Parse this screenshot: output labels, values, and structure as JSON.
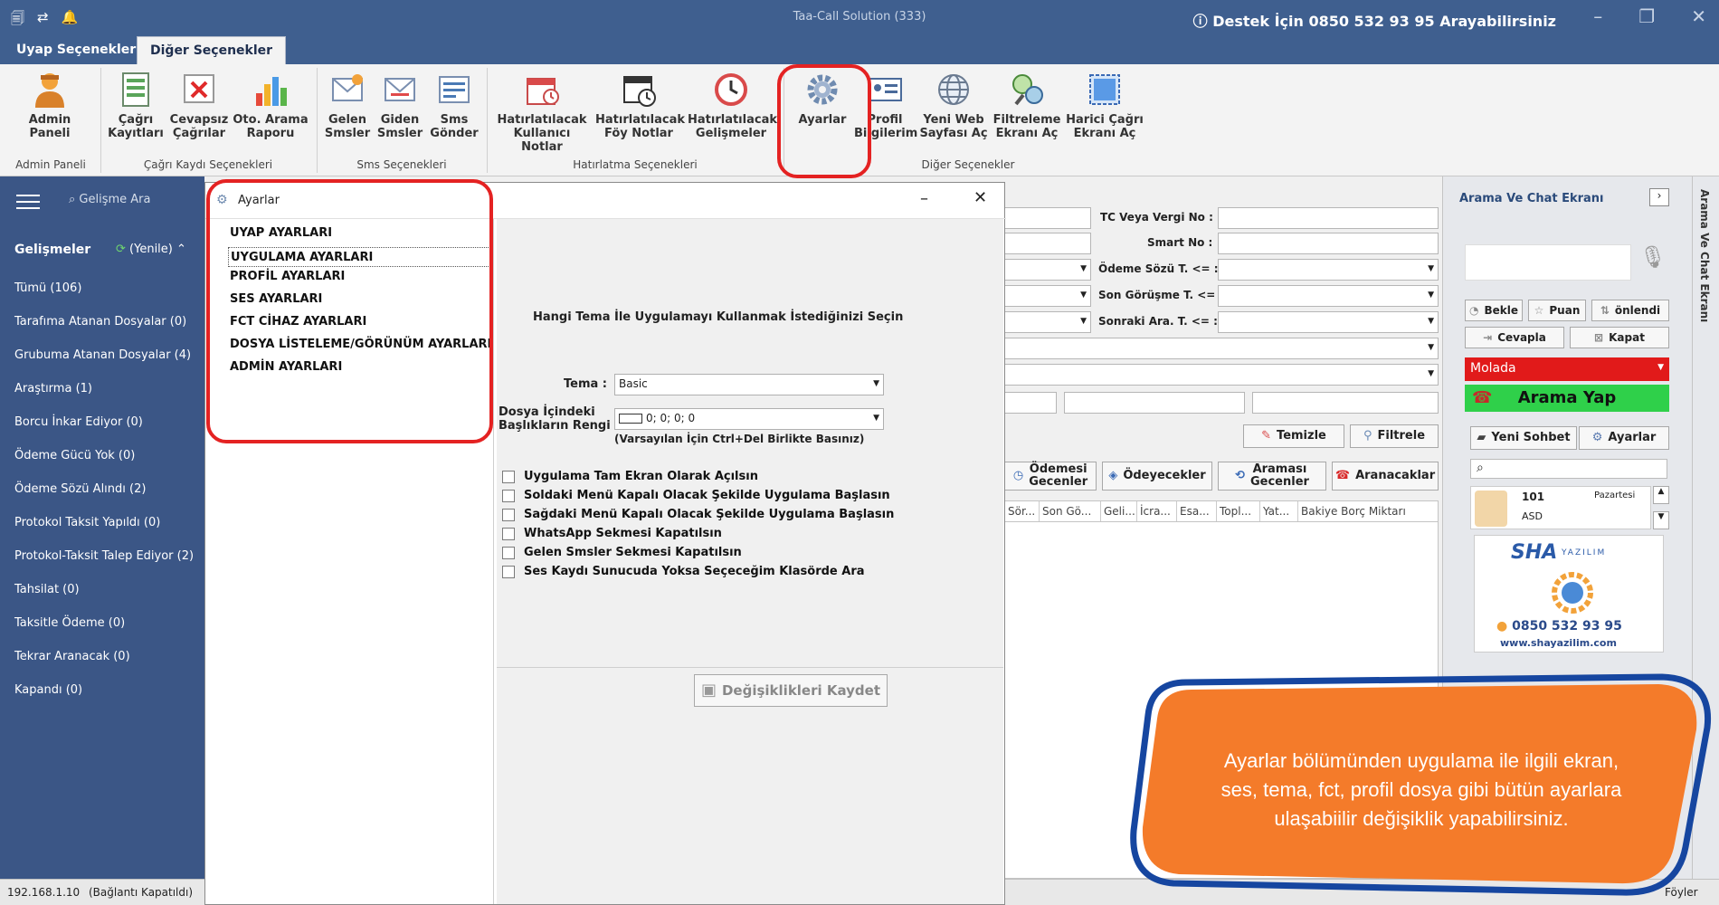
{
  "window": {
    "title": "Taa-Call Solution (333)",
    "support_text": "Destek İçin 0850 532 93 95 Arayabilirsiniz"
  },
  "tabs": [
    {
      "label": "Uyap Seçenekler",
      "active": false
    },
    {
      "label": "Diğer Seçenekler",
      "active": true
    }
  ],
  "ribbon": {
    "buttons": [
      {
        "l1": "Admin",
        "l2": "Paneli",
        "icon": "admin-person-icon"
      },
      {
        "l1": "Çağrı",
        "l2": "Kayıtları",
        "icon": "call-records-icon"
      },
      {
        "l1": "Cevapsız",
        "l2": "Çağrılar",
        "icon": "missed-calls-icon"
      },
      {
        "l1": "Oto. Arama",
        "l2": "Raporu",
        "icon": "bar-chart-icon"
      },
      {
        "l1": "Gelen",
        "l2": "Smsler",
        "icon": "incoming-sms-icon"
      },
      {
        "l1": "Giden",
        "l2": "Smsler",
        "icon": "outgoing-sms-icon"
      },
      {
        "l1": "Sms",
        "l2": "Gönder",
        "icon": "send-sms-icon"
      },
      {
        "l1": "Hatırlatılacak",
        "l2": "Kullanıcı Notlar",
        "icon": "calendar-alarm-icon"
      },
      {
        "l1": "Hatırlatılacak",
        "l2": "Föy Notlar",
        "icon": "calendar-clock-icon"
      },
      {
        "l1": "Hatırlatılacak",
        "l2": "Gelişmeler",
        "icon": "clock-icon"
      },
      {
        "l1": "Ayarlar",
        "l2": "",
        "icon": "gear-icon"
      },
      {
        "l1": "Profil",
        "l2": "Bilgilerim",
        "icon": "profile-card-icon"
      },
      {
        "l1": "Yeni Web",
        "l2": "Sayfası Aç",
        "icon": "globe-icon"
      },
      {
        "l1": "Filtreleme",
        "l2": "Ekranı Aç",
        "icon": "filter-icon"
      },
      {
        "l1": "Harici Çağrı",
        "l2": "Ekranı Aç",
        "icon": "external-window-icon"
      }
    ],
    "groups": [
      "Admin Paneli",
      "Çağrı Kaydı Seçenekleri",
      "Sms Seçenekleri",
      "Hatırlatma Seçenekleri",
      "Diğer Seçenekler"
    ]
  },
  "sidebar": {
    "search_placeholder": "Gelişme Ara",
    "section_title": "Gelişmeler",
    "refresh_label": "(Yenile)",
    "items": [
      "Tümü (106)",
      "Tarafıma Atanan Dosyalar (0)",
      "Grubuma Atanan Dosyalar (4)",
      "Araştırma (1)",
      "Borcu İnkar Ediyor (0)",
      "Ödeme Gücü Yok (0)",
      "Ödeme Sözü Alındı (2)",
      "Protokol Taksit Yapıldı (0)",
      "Protokol-Taksit Talep Ediyor (2)",
      "Tahsilat (0)",
      "Taksitle Ödeme (0)",
      "Tekrar Aranacak (0)",
      "Kapandı (0)"
    ]
  },
  "status": {
    "ip": "192.168.1.10",
    "connection": "(Bağlantı Kapatıldı)",
    "right_text": "Föyler"
  },
  "background_form": {
    "labels": [
      "TC Veya Vergi No :",
      "Smart No :",
      "Ödeme Sözü T. <= :",
      "Son Görüşme T. <= :",
      "Sonraki Ara. T. <= :"
    ],
    "clear_button": "Temizle",
    "filter_button": "Filtrele",
    "action_buttons": [
      {
        "l1": "Ödemesi",
        "l2": "Gecenler"
      },
      {
        "l1": "Ödeyecekler",
        "l2": ""
      },
      {
        "l1": "Araması",
        "l2": "Gecenler"
      },
      {
        "l1": "Aranacaklar",
        "l2": ""
      }
    ],
    "columns": [
      "Sör...",
      "Son Gö...",
      "Geli...",
      "İcra...",
      "Esa...",
      "Topl...",
      "Yat...",
      "Bakiye Borç Miktarı"
    ]
  },
  "chat": {
    "title": "Arama Ve Chat Ekranı",
    "vertical_title": "Arama Ve Chat Ekranı",
    "buttons": {
      "wait": "Bekle",
      "rate": "Puan",
      "priority": "önlendi",
      "answer": "Cevapla",
      "close": "Kapat"
    },
    "status_text": "Molada",
    "call_button": "Arama Yap",
    "new_chat": "Yeni Sohbet",
    "callers": "Ayarlar",
    "contact": {
      "number": "101",
      "day": "Pazartesi",
      "name": "ASD"
    },
    "ad": {
      "brand": "SHA",
      "brand2": "YAZILIM",
      "phone": "0850 532 93 95",
      "web": "www.shayazilim.com"
    }
  },
  "dialog": {
    "title": "Ayarlar",
    "menu": [
      {
        "label": "UYAP AYARLARI",
        "selected": false
      },
      {
        "label": "UYGULAMA AYARLARI",
        "selected": true
      },
      {
        "label": "PROFİL AYARLARI",
        "selected": false
      },
      {
        "label": "SES AYARLARI",
        "selected": false
      },
      {
        "label": "FCT CİHAZ AYARLARI",
        "selected": false
      },
      {
        "label": "DOSYA LİSTELEME/GÖRÜNÜM AYARLARI",
        "selected": false
      },
      {
        "label": "ADMİN AYARLARI",
        "selected": false
      }
    ],
    "theme_heading": "Hangi Tema İle Uygulamayı Kullanmak İstediğinizi Seçin",
    "theme_label": "Tema :",
    "theme_value": "Basic",
    "color_label_1": "Dosya İçindeki",
    "color_label_2": "Başlıkların Rengi :",
    "color_value": "0; 0; 0; 0",
    "color_hint": "(Varsayılan İçin Ctrl+Del Birlikte Basınız)",
    "checkboxes": [
      "Uygulama Tam Ekran Olarak Açılsın",
      "Soldaki Menü Kapalı Olacak Şekilde Uygulama Başlasın",
      "Sağdaki Menü Kapalı Olacak Şekilde Uygulama Başlasın",
      "WhatsApp Sekmesi Kapatılsın",
      "Gelen Smsler Sekmesi Kapatılsın",
      "Ses Kaydı Sunucuda Yoksa Seçeceğim Klasörde Ara"
    ],
    "save_button": "Değişiklikleri Kaydet"
  },
  "callout": {
    "text_l1": "Ayarlar bölümünden uygulama ile ilgili ekran,",
    "text_l2": "ses, tema, fct, profil dosya gibi bütün ayarlara",
    "text_l3": "ulaşabiilir değişiklik yapabilirsiniz.",
    "fill": "#f47b2a",
    "border": "#1646a0"
  },
  "colors": {
    "titlebar": "#3f5f8f",
    "sidebar": "#3b5686",
    "highlight": "#e42222",
    "status_red": "#e11a1a",
    "call_green": "#2fd04a"
  }
}
